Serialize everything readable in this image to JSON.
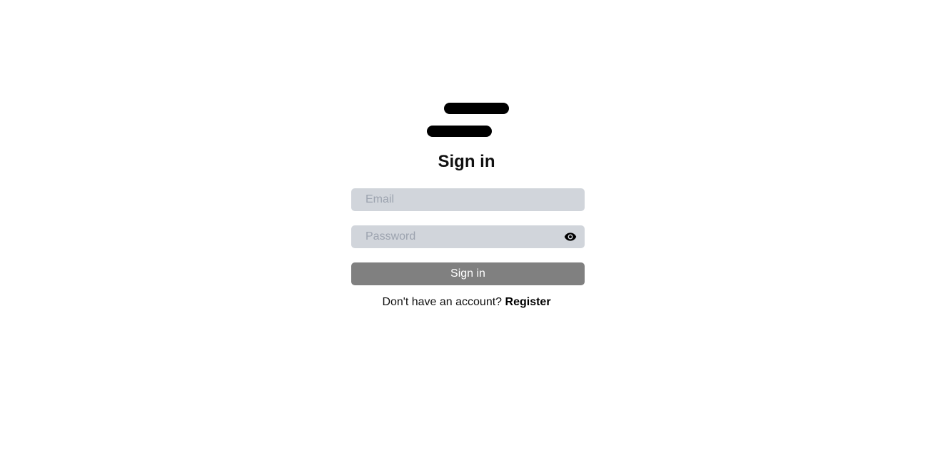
{
  "logo": {
    "icon": "two-bars-logo"
  },
  "form": {
    "title": "Sign in",
    "email": {
      "placeholder": "Email",
      "value": ""
    },
    "password": {
      "placeholder": "Password",
      "value": "",
      "toggle_icon": "eye-icon"
    },
    "submit_label": "Sign in",
    "register_prompt": "Don't have an account?",
    "register_link": "Register"
  },
  "colors": {
    "field_background": "#d1d5db",
    "button_background": "#808080",
    "text": "#111111"
  }
}
